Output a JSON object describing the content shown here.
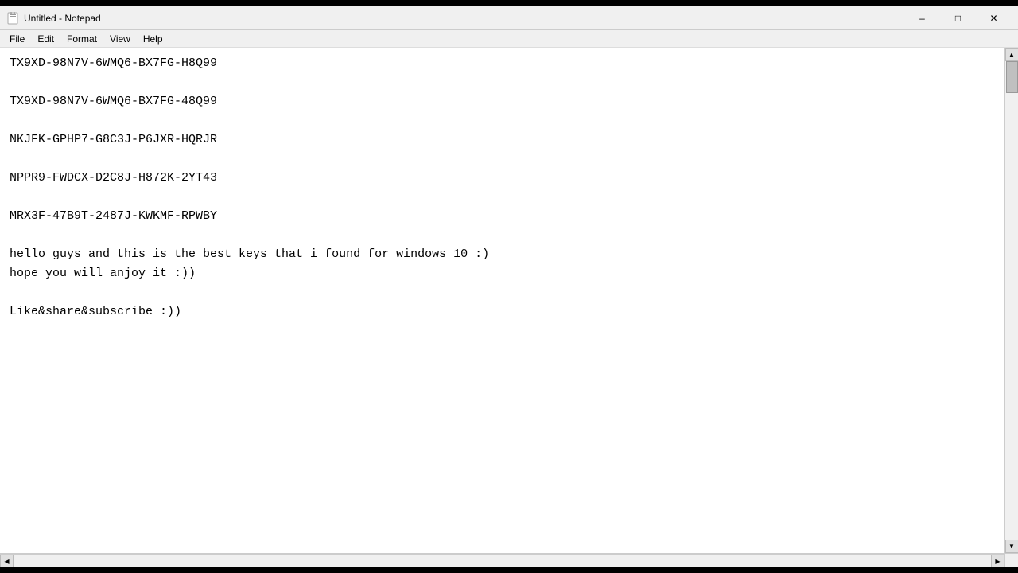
{
  "titleBar": {
    "icon": "notepad",
    "title": "Untitled - Notepad",
    "minimize": "–",
    "maximize": "□",
    "close": "✕"
  },
  "menuBar": {
    "items": [
      "File",
      "Edit",
      "Format",
      "View",
      "Help"
    ]
  },
  "content": {
    "lines": [
      "TX9XD-98N7V-6WMQ6-BX7FG-H8Q99",
      "",
      "TX9XD-98N7V-6WMQ6-BX7FG-48Q99",
      "",
      "NKJFK-GPHP7-G8C3J-P6JXR-HQRJR",
      "",
      "NPPR9-FWDCX-D2C8J-H872K-2YT43",
      "",
      "MRX3F-47B9T-2487J-KWKMF-RPWBY",
      "",
      "hello guys and this is the best keys that i found for windows 10 :)",
      "hope you will anjoy it :))",
      "",
      "Like&share&subscribe :))"
    ]
  }
}
